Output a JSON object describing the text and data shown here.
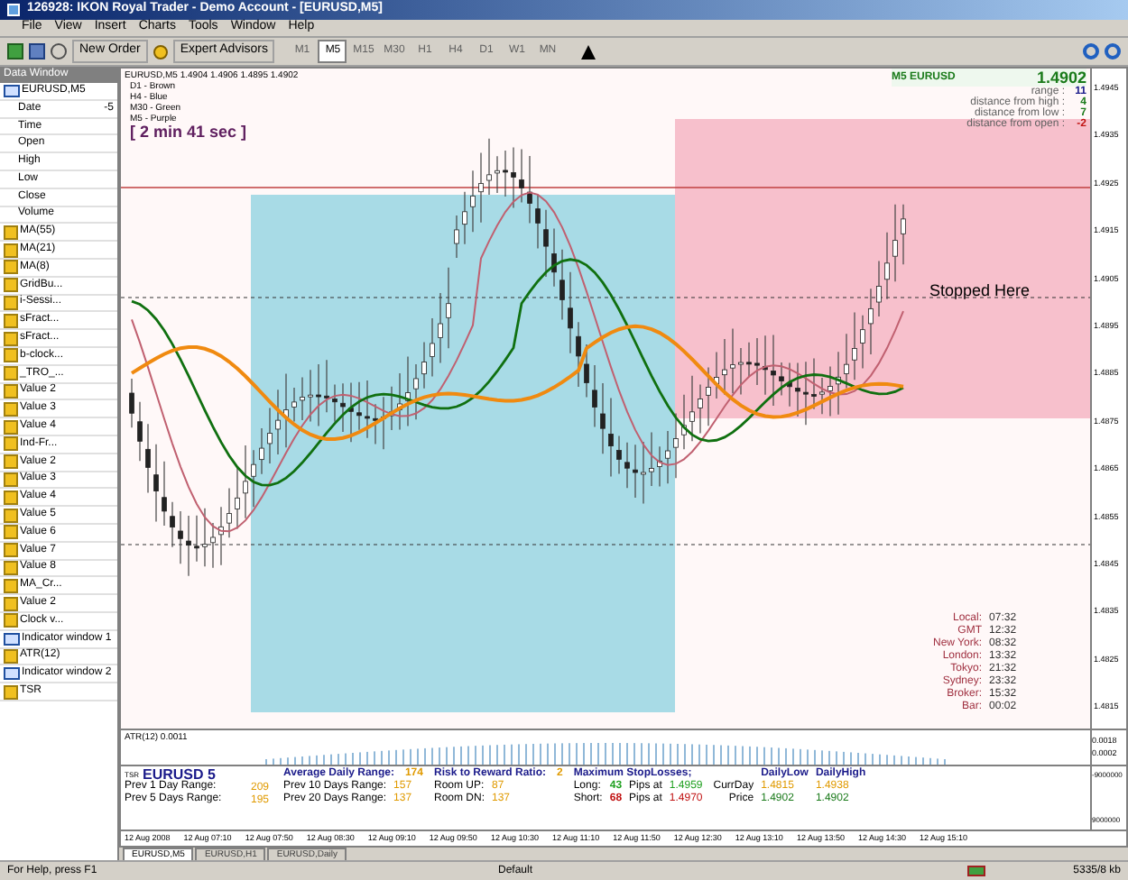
{
  "window": {
    "title": "126928: IKON Royal Trader - Demo Account - [EURUSD,M5]"
  },
  "menu": [
    "File",
    "View",
    "Insert",
    "Charts",
    "Tools",
    "Window",
    "Help"
  ],
  "toolbar": {
    "new_order": "New Order",
    "expert_advisors": "Expert Advisors",
    "timeframes": [
      {
        "label": "M1",
        "selected": false
      },
      {
        "label": "M5",
        "selected": true
      },
      {
        "label": "M15",
        "selected": false
      },
      {
        "label": "M30",
        "selected": false
      },
      {
        "label": "H1",
        "selected": false
      },
      {
        "label": "H4",
        "selected": false
      },
      {
        "label": "D1",
        "selected": false
      },
      {
        "label": "W1",
        "selected": false
      },
      {
        "label": "MN",
        "selected": false
      }
    ]
  },
  "data_window": {
    "title": "Data Window",
    "rows": [
      {
        "kind": "symbol",
        "label": "EURUSD,M5"
      },
      {
        "kind": "field",
        "label": "Date",
        "value": "-5"
      },
      {
        "kind": "field",
        "label": "Time"
      },
      {
        "kind": "field",
        "label": "Open"
      },
      {
        "kind": "field",
        "label": "High"
      },
      {
        "kind": "field",
        "label": "Low"
      },
      {
        "kind": "field",
        "label": "Close"
      },
      {
        "kind": "field",
        "label": "Volume"
      },
      {
        "kind": "indicator",
        "label": "MA(55)"
      },
      {
        "kind": "indicator",
        "label": "MA(21)"
      },
      {
        "kind": "indicator",
        "label": "MA(8)"
      },
      {
        "kind": "indicator",
        "label": "GridBu..."
      },
      {
        "kind": "indicator",
        "label": "i-Sessi..."
      },
      {
        "kind": "indicator",
        "label": "sFract..."
      },
      {
        "kind": "indicator",
        "label": "sFract..."
      },
      {
        "kind": "indicator",
        "label": "b-clock..."
      },
      {
        "kind": "indicator",
        "label": "_TRO_..."
      },
      {
        "kind": "indicator",
        "label": "Value 2"
      },
      {
        "kind": "indicator",
        "label": "Value 3"
      },
      {
        "kind": "indicator",
        "label": "Value 4"
      },
      {
        "kind": "indicator",
        "label": "Ind-Fr..."
      },
      {
        "kind": "indicator",
        "label": "Value 2"
      },
      {
        "kind": "indicator",
        "label": "Value 3"
      },
      {
        "kind": "indicator",
        "label": "Value 4"
      },
      {
        "kind": "indicator",
        "label": "Value 5"
      },
      {
        "kind": "indicator",
        "label": "Value 6"
      },
      {
        "kind": "indicator",
        "label": "Value 7"
      },
      {
        "kind": "indicator",
        "label": "Value 8"
      },
      {
        "kind": "indicator",
        "label": "MA_Cr..."
      },
      {
        "kind": "indicator",
        "label": "Value 2"
      },
      {
        "kind": "indicator",
        "label": "Clock v..."
      },
      {
        "kind": "window",
        "label": "Indicator window 1"
      },
      {
        "kind": "indicator",
        "label": "ATR(12)"
      },
      {
        "kind": "window",
        "label": "Indicator window 2"
      },
      {
        "kind": "indicator",
        "label": "TSR"
      }
    ]
  },
  "chart": {
    "info_line": "EURUSD,M5  1.4904 1.4906 1.4895 1.4902",
    "legend": [
      "D1 - Brown",
      "H4 - Blue",
      "M30 - Green",
      "M5 - Purple"
    ],
    "timer": "[ 2 min 41 sec ]",
    "stopped_label": "Stopped Here",
    "info_box": {
      "symbol": "M5 EURUSD",
      "price": "1.4902",
      "rows": [
        {
          "label": "range :",
          "value": "11",
          "color": "#1a1a8a"
        },
        {
          "label": "distance from high :",
          "value": "4",
          "color": "#1a7a1a"
        },
        {
          "label": "distance from low :",
          "value": "7",
          "color": "#1a7a1a"
        },
        {
          "label": "distance from open :",
          "value": "-2",
          "color": "#c01010"
        }
      ]
    },
    "clocks": [
      {
        "label": "Local:",
        "value": "07:32"
      },
      {
        "label": "GMT",
        "value": "12:32"
      },
      {
        "label": "New York:",
        "value": "08:32"
      },
      {
        "label": "London:",
        "value": "13:32"
      },
      {
        "label": "Tokyo:",
        "value": "21:32"
      },
      {
        "label": "Sydney:",
        "value": "23:32"
      },
      {
        "label": "Broker:",
        "value": "15:32"
      },
      {
        "label": "Bar:",
        "value": "00:02"
      }
    ],
    "price_axis": [
      "1.4945",
      "1.4935",
      "1.4925",
      "1.4915",
      "1.4905",
      "1.4895",
      "1.4885",
      "1.4875",
      "1.4865",
      "1.4855",
      "1.4845",
      "1.4835",
      "1.4825",
      "1.4815"
    ]
  },
  "atr": {
    "label": "ATR(12) 0.0011",
    "axis": [
      "0.0018",
      "0.0002"
    ]
  },
  "tsr": {
    "tag": "TSR",
    "symbol": "EURUSD 5",
    "adr_label": "Average Daily Range:",
    "adr": "174",
    "rr_label": "Risk to Reward Ratio:",
    "rr": "2",
    "msl_label": "Maximum StopLosses;",
    "daily_low": "DailyLow",
    "daily_high": "DailyHigh",
    "prev1_label": "Prev 1 Day Range:",
    "prev1": "209",
    "prev5_label": "Prev 5 Days Range:",
    "prev5": "195",
    "prev10_label": "Prev 10 Days Range:",
    "prev10": "157",
    "prev20_label": "Prev 20 Days Range:",
    "prev20": "137",
    "room_up_label": "Room UP:",
    "room_up": "87",
    "room_dn_label": "Room DN:",
    "room_dn": "137",
    "long_label": "Long:",
    "long": "43",
    "short_label": "Short:",
    "short": "68",
    "pips_at_1": "Pips at",
    "long_price": "1.4959",
    "pips_at_2": "Pips at",
    "short_price": "1.4970",
    "curr_day": "CurrDay",
    "price_label": "Price",
    "curr_low": "1.4815",
    "curr_high": "1.4938",
    "price_low": "1.4902",
    "price_high": "1.4902",
    "axis": [
      "-9000000",
      "9000000"
    ]
  },
  "time_axis": [
    "12 Aug 2008",
    "12 Aug 07:10",
    "12 Aug 07:50",
    "12 Aug 08:30",
    "12 Aug 09:10",
    "12 Aug 09:50",
    "12 Aug 10:30",
    "12 Aug 11:10",
    "12 Aug 11:50",
    "12 Aug 12:30",
    "12 Aug 13:10",
    "12 Aug 13:50",
    "12 Aug 14:30",
    "12 Aug 15:10"
  ],
  "tabs": [
    {
      "label": "EURUSD,M5",
      "selected": true
    },
    {
      "label": "EURUSD,H1",
      "selected": false
    },
    {
      "label": "EURUSD,Daily",
      "selected": false
    }
  ],
  "status": {
    "help": "For Help, press F1",
    "profile": "Default",
    "traffic": "5335/8 kb"
  }
}
